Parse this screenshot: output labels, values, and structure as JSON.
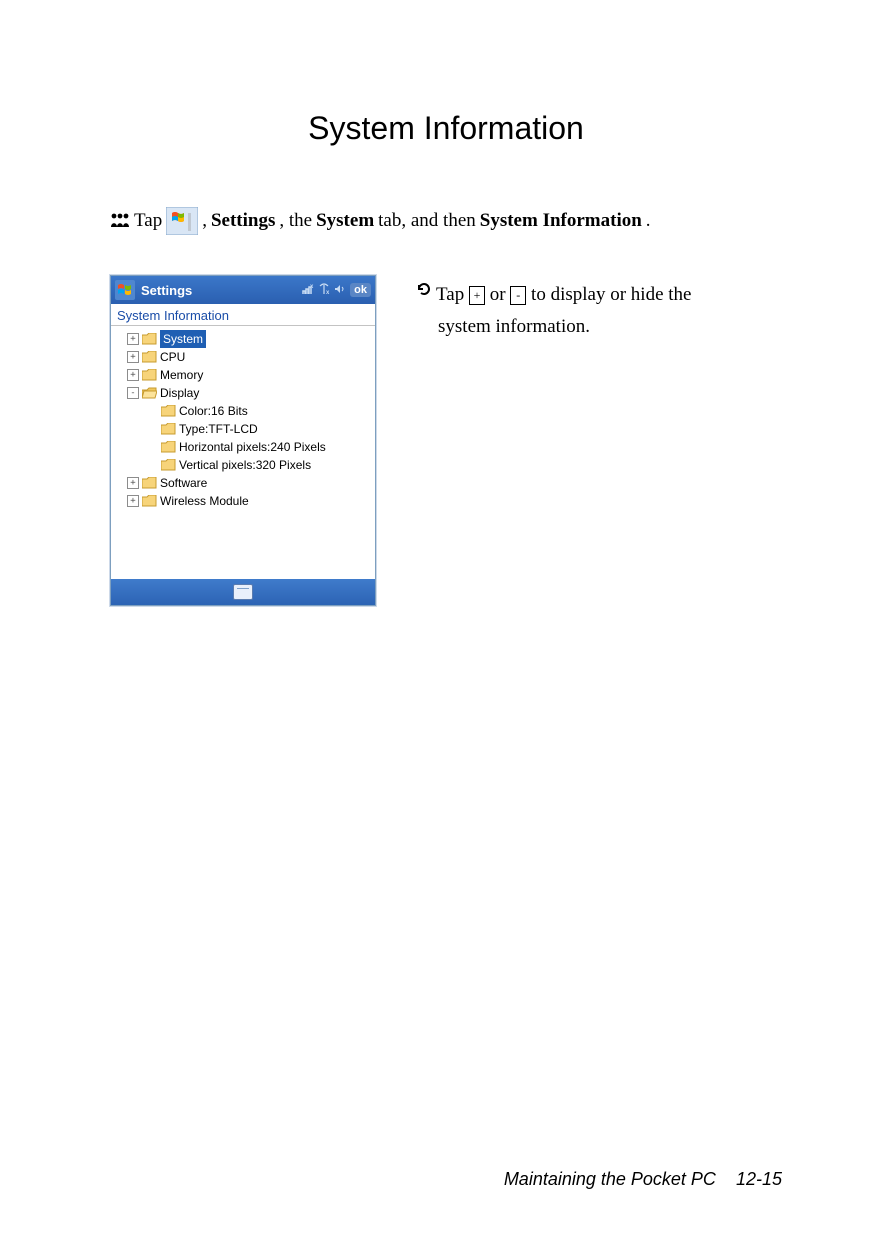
{
  "title": "System Information",
  "instruction": {
    "tap_word": "Tap",
    "sep1": ", ",
    "settings": "Settings",
    "sep2": ", the ",
    "system_tab": "System",
    "sep3": " tab, and then ",
    "sys_info": "System Information",
    "end": "."
  },
  "device": {
    "titlebar_label": "Settings",
    "ok_label": "ok",
    "app_header": "System Information",
    "tree": {
      "system": "System",
      "cpu": "CPU",
      "memory": "Memory",
      "display": "Display",
      "display_children": {
        "color": "Color:16 Bits",
        "type": "Type:TFT-LCD",
        "hpixels": "Horizontal pixels:240 Pixels",
        "vpixels": "Vertical pixels:320 Pixels"
      },
      "software": "Software",
      "wireless": "Wireless Module"
    }
  },
  "note": {
    "prefix": "Tap ",
    "plus": "+",
    "mid": " or ",
    "minus": "-",
    "suffix": " to display or hide the",
    "line2": "system information."
  },
  "footer": {
    "text": "Maintaining the Pocket PC",
    "page": "12-15"
  }
}
